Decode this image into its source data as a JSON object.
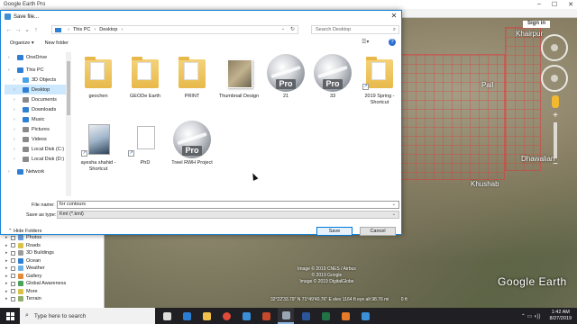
{
  "app": {
    "title": "Google Earth Pro",
    "sign_in": "Sign in",
    "logo": "Google Earth",
    "status": "32°22'33.79\" N 71°49'40.76\" E elev 1164 ft eye alt 98.76 mi",
    "copyright": [
      "Image © 2019 CNES / Airbus",
      "© 2019 Google",
      "Image © 2019 DigitalGlobe"
    ],
    "scale": "0 ft",
    "places": [
      "Khairpur",
      "Pail",
      "Dhawalian",
      "Khushab"
    ]
  },
  "dialog": {
    "title": "Save file...",
    "path": [
      "This PC",
      "Desktop"
    ],
    "search_placeholder": "Search Desktop",
    "organize": "Organize ▾",
    "new_folder": "New folder",
    "file_name_label": "File name:",
    "file_name_value": "for contours",
    "save_as_type_label": "Save as type:",
    "save_as_type_value": "Kml (*.kml)",
    "hide_folders": "Hide Folders",
    "save": "Save",
    "cancel": "Cancel"
  },
  "navpane": [
    {
      "label": "OneDrive",
      "level": 0,
      "icon_color": "#2f7fd3"
    },
    {
      "label": "This PC",
      "level": 0,
      "icon_color": "#2f7fd3"
    },
    {
      "label": "3D Objects",
      "level": 1,
      "icon_color": "#4aa3e6"
    },
    {
      "label": "Desktop",
      "level": 1,
      "icon_color": "#2f7fd3",
      "selected": true
    },
    {
      "label": "Documents",
      "level": 1,
      "icon_color": "#8a8a8a"
    },
    {
      "label": "Downloads",
      "level": 1,
      "icon_color": "#2f7fd3"
    },
    {
      "label": "Music",
      "level": 1,
      "icon_color": "#2f7fd3"
    },
    {
      "label": "Pictures",
      "level": 1,
      "icon_color": "#8a8a8a"
    },
    {
      "label": "Videos",
      "level": 1,
      "icon_color": "#8a8a8a"
    },
    {
      "label": "Local Disk (C:)",
      "level": 1,
      "icon_color": "#8a8a8a"
    },
    {
      "label": "Local Disk (D:)",
      "level": 1,
      "icon_color": "#8a8a8a"
    },
    {
      "label": "Network",
      "level": 0,
      "icon_color": "#2f7fd3"
    }
  ],
  "files": [
    {
      "name": "",
      "kind": "folder"
    },
    {
      "name": "",
      "kind": "folder"
    },
    {
      "name": "",
      "kind": "folder"
    },
    {
      "name": "",
      "kind": "thumb"
    },
    {
      "name": "",
      "kind": "pro"
    },
    {
      "name": "",
      "kind": "pro"
    },
    {
      "name": "",
      "kind": "folder"
    },
    {
      "name": "geochen",
      "kind": "folder"
    },
    {
      "name": "GEODe Earth",
      "kind": "folder"
    },
    {
      "name": "PRINT",
      "kind": "folder"
    },
    {
      "name": "Thumbnail Design",
      "kind": "thumb"
    },
    {
      "name": "21",
      "kind": "pro"
    },
    {
      "name": "33",
      "kind": "pro"
    },
    {
      "name": "2019 Spring - Shortcut",
      "kind": "folder"
    },
    {
      "name": "ayesha shahid - Shortcut",
      "kind": "book"
    },
    {
      "name": "PhD",
      "kind": "blank"
    },
    {
      "name": "Treel RWH Project",
      "kind": "pro"
    }
  ],
  "layers": [
    {
      "label": "Terrain",
      "icon_color": "#8fae6b"
    },
    {
      "label": "Photos",
      "icon_color": "#6fa0d8"
    },
    {
      "label": "Roads",
      "icon_color": "#d9c14a"
    },
    {
      "label": "3D Buildings",
      "icon_color": "#9b9b9b"
    },
    {
      "label": "Ocean",
      "icon_color": "#2f7fd3"
    },
    {
      "label": "Weather",
      "icon_color": "#6fb3e6"
    },
    {
      "label": "Gallery",
      "icon_color": "#e48a3a"
    },
    {
      "label": "Global Awareness",
      "icon_color": "#4aa35a"
    },
    {
      "label": "More",
      "icon_color": "#d9c14a"
    },
    {
      "label": "Terrain",
      "icon_color": "#8fae6b"
    }
  ],
  "taskbar": {
    "search_placeholder": "Type here to search",
    "apps": [
      {
        "name": "task-view",
        "color": "#dddddd"
      },
      {
        "name": "edge",
        "color": "#2b7cd3"
      },
      {
        "name": "file-explorer",
        "color": "#f0c14a"
      },
      {
        "name": "chrome",
        "color": "#e04b3a"
      },
      {
        "name": "photos",
        "color": "#3a8fd8"
      },
      {
        "name": "powerpoint",
        "color": "#c8482b"
      },
      {
        "name": "google-earth",
        "color": "#9aa6b3",
        "active": true
      },
      {
        "name": "word",
        "color": "#2b579a"
      },
      {
        "name": "excel",
        "color": "#217346"
      },
      {
        "name": "media",
        "color": "#e87b2a"
      },
      {
        "name": "mail",
        "color": "#3a8fd8"
      }
    ],
    "time": "1:42 AM",
    "date": "8/27/2019"
  }
}
